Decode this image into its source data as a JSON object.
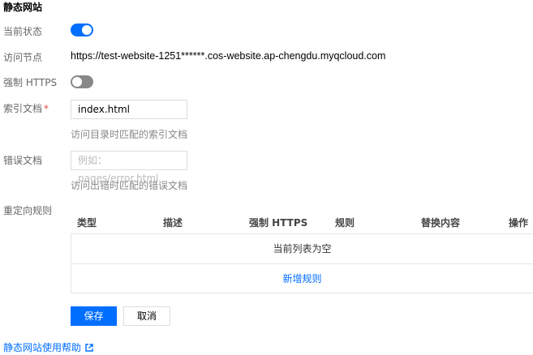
{
  "section_title": "静态网站",
  "status": {
    "label": "当前状态",
    "enabled": true
  },
  "endpoint": {
    "label": "访问节点",
    "url": "https://test-website-1251******.cos-website.ap-chengdu.myqcloud.com"
  },
  "force_https": {
    "label": "强制 HTTPS",
    "enabled": false
  },
  "index_doc": {
    "label": "索引文档",
    "required_mark": "*",
    "value": "index.html",
    "hint": "访问目录时匹配的索引文档"
  },
  "error_doc": {
    "label": "错误文档",
    "placeholder": "例如：pages/error.html",
    "hint": "访问出错时匹配的错误文档"
  },
  "redirect_rules": {
    "label": "重定向规则",
    "columns": [
      "类型",
      "描述",
      "强制 HTTPS",
      "规则",
      "替换内容",
      "操作"
    ],
    "empty_text": "当前列表为空",
    "add_label": "新增规则"
  },
  "actions": {
    "save_label": "保存",
    "cancel_label": "取消"
  },
  "help_link": {
    "label": "静态网站使用帮助",
    "icon": "external-link-icon"
  },
  "colors": {
    "accent": "#006eff",
    "toggle_off": "#888888",
    "required": "#e54545"
  }
}
